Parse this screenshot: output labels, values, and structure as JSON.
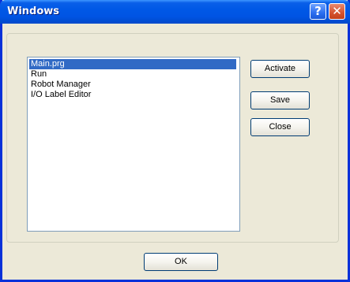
{
  "window": {
    "title": "Windows"
  },
  "caption_buttons": {
    "help": "?",
    "close": "✕"
  },
  "list": {
    "items": [
      "Main.prg",
      "Run",
      "Robot Manager",
      "I/O Label Editor"
    ],
    "selected_index": 0
  },
  "buttons": {
    "activate": "Activate",
    "save": "Save",
    "close": "Close",
    "ok": "OK"
  },
  "colors": {
    "titlebar": "#0054e3",
    "selection": "#316ac5",
    "face": "#ece9d8",
    "button_border": "#003c74"
  }
}
